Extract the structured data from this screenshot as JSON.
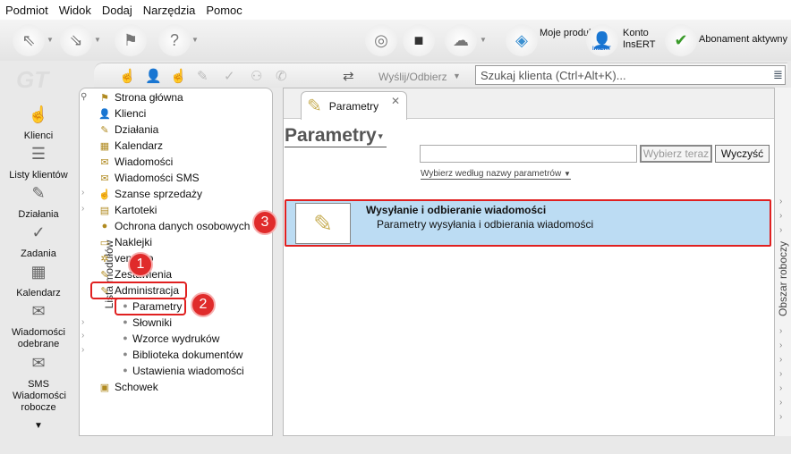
{
  "menu": [
    "Podmiot",
    "Widok",
    "Dodaj",
    "Narzędzia",
    "Pomoc"
  ],
  "toolbar": {
    "moje_produkty": "Moje produkty",
    "konto": "Konto InsERT",
    "insert_logo": "InsERT",
    "abonament": "Abonament aktywny"
  },
  "logo": "GT",
  "sidebar": [
    {
      "label": "Klienci"
    },
    {
      "label": "Listy klientów"
    },
    {
      "label": "Działania"
    },
    {
      "label": "Zadania"
    },
    {
      "label": "Kalendarz"
    },
    {
      "label": "Wiadomości odebrane"
    },
    {
      "label": "SMS Wiadomości robocze"
    }
  ],
  "toolbar2": {
    "send_receive": "Wyślij/Odbierz",
    "search_placeholder": "Szukaj klienta (Ctrl+Alt+K)..."
  },
  "modules": {
    "panel_label": "Lista modułów",
    "items": [
      "Strona główna",
      "Klienci",
      "Działania",
      "Kalendarz",
      "Wiadomości",
      "Wiadomości SMS",
      "Szanse sprzedaży",
      "Kartoteki",
      "Ochrona danych osobowych",
      "Naklejki",
      "vendero",
      "Zestawienia",
      "Administracja"
    ],
    "sub_items": [
      "Parametry",
      "Słowniki",
      "Wzorce wydruków",
      "Biblioteka dokumentów",
      "Ustawienia wiadomości"
    ],
    "last": "Schowek"
  },
  "content": {
    "tab": "Parametry",
    "title": "Parametry",
    "choose_now": "Wybierz teraz",
    "clear": "Wyczyść",
    "sort_link": "Wybierz według nazwy parametrów",
    "row": {
      "title": "Wysyłanie i odbieranie wiadomości",
      "subtitle": "Parametry wysyłania i odbierania wiadomości"
    }
  },
  "right_panel": "Obszar roboczy",
  "badges": [
    "1",
    "2",
    "3"
  ]
}
